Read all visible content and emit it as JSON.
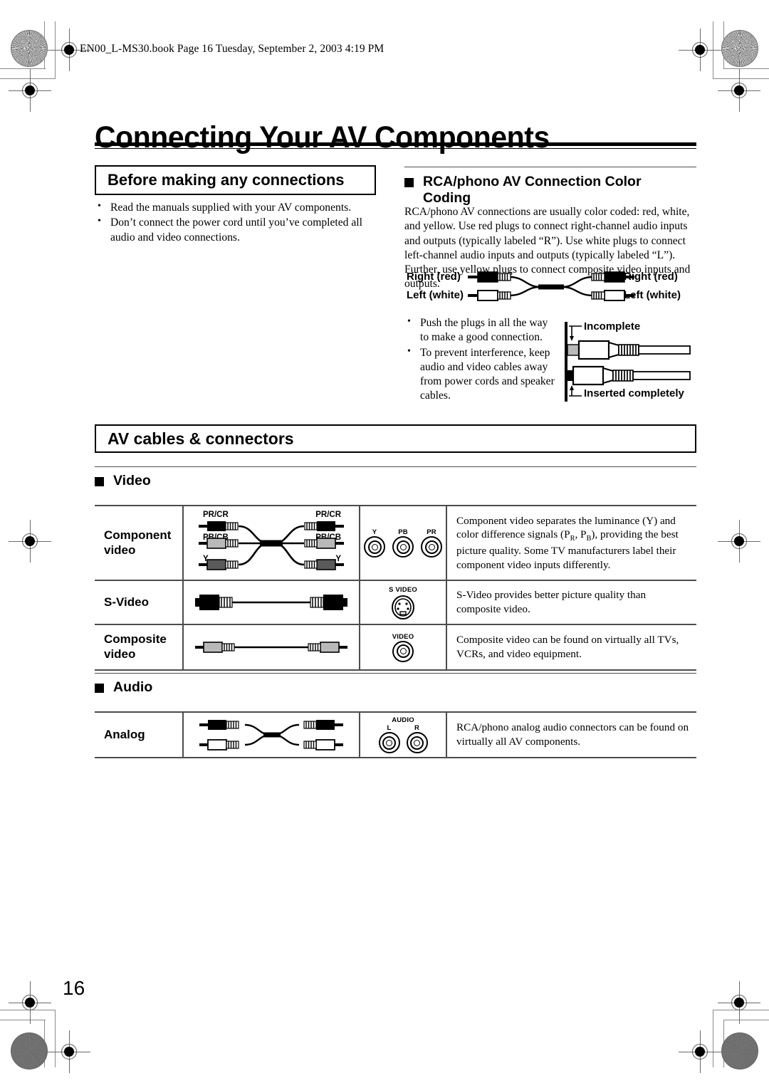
{
  "document": {
    "book_line": "EN00_L-MS30.book  Page 16  Tuesday, September 2, 2003  4:19 PM",
    "title": "Connecting Your AV Components",
    "page_number": "16"
  },
  "before_connections": {
    "heading": "Before making any connections",
    "bullets": [
      "Read the manuals supplied with your AV components.",
      "Don’t connect the power cord until you’ve completed all audio and video connections."
    ]
  },
  "color_coding": {
    "heading": "RCA/phono AV Connection Color Coding",
    "paragraph": "RCA/phono AV connections are usually color coded: red, white, and yellow. Use red plugs to connect right-channel audio inputs and outputs (typically labeled “R”). Use white plugs to connect left-channel audio inputs and outputs (typically labeled “L”). Further, use yellow plugs to connect composite video inputs and outputs.",
    "cable_labels": {
      "right_left": "Right (red)",
      "left_left": "Left (white)",
      "right_right": "Right (red)",
      "left_right": "Left (white)"
    },
    "bullets": [
      "Push the plugs in all the way to make a good connection.",
      "To prevent interference, keep audio and video cables away from power cords and speaker cables."
    ],
    "insertion_labels": {
      "incomplete": "Incomplete",
      "inserted": "Inserted completely"
    }
  },
  "cables_connectors": {
    "heading": "AV cables & connectors",
    "video": {
      "heading": "Video",
      "rows": [
        {
          "name": "Component video",
          "cable_labels": [
            "PR/CR",
            "PB/CB",
            "Y"
          ],
          "jack_labels": [
            "Y",
            "PB",
            "PR"
          ],
          "jack_title": "",
          "description": "Component video separates the luminance (Y) and color difference signals (PR, PB), providing the best picture quality. Some TV manufacturers label their component video inputs differently."
        },
        {
          "name": "S-Video",
          "cable_labels": [],
          "jack_labels": [],
          "jack_title": "S VIDEO",
          "description": "S-Video provides better picture quality than composite video."
        },
        {
          "name": "Composite video",
          "cable_labels": [],
          "jack_labels": [],
          "jack_title": "VIDEO",
          "description": "Composite video can be found on virtually all TVs, VCRs, and video equipment."
        }
      ]
    },
    "audio": {
      "heading": "Audio",
      "rows": [
        {
          "name": "Analog",
          "jack_title": "AUDIO",
          "jack_labels": [
            "L",
            "R"
          ],
          "description": "RCA/phono analog audio connectors can be found on virtually all AV components."
        }
      ]
    }
  },
  "colors": {
    "rule": "#4c4c4c",
    "reg_mark": "#6a6a6a",
    "plug_red": "#000000",
    "plug_white": "#ffffff",
    "plug_blue_grey": "#b9b9b9",
    "plug_dark_grey": "#5a5a5a"
  }
}
